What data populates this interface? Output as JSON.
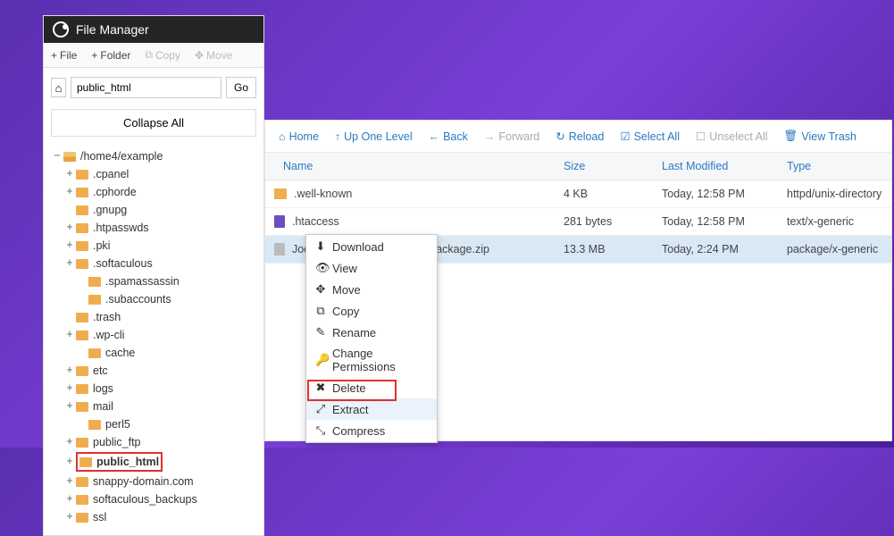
{
  "title": "File Manager",
  "toolbar": {
    "file": "File",
    "folder": "Folder",
    "copy": "Copy",
    "move": "Move"
  },
  "path_input": "public_html",
  "go": "Go",
  "collapse": "Collapse All",
  "tree": {
    "root": "/home4/example",
    "items": [
      {
        "label": ".cpanel",
        "exp": true,
        "ind": 1
      },
      {
        "label": ".cphorde",
        "exp": true,
        "ind": 1
      },
      {
        "label": ".gnupg",
        "exp": false,
        "ind": 1
      },
      {
        "label": ".htpasswds",
        "exp": true,
        "ind": 1
      },
      {
        "label": ".pki",
        "exp": true,
        "ind": 1
      },
      {
        "label": ".softaculous",
        "exp": true,
        "ind": 1
      },
      {
        "label": ".spamassassin",
        "exp": false,
        "ind": 2
      },
      {
        "label": ".subaccounts",
        "exp": false,
        "ind": 2
      },
      {
        "label": ".trash",
        "exp": false,
        "ind": 1
      },
      {
        "label": ".wp-cli",
        "exp": true,
        "ind": 1
      },
      {
        "label": "cache",
        "exp": false,
        "ind": 2
      },
      {
        "label": "etc",
        "exp": true,
        "ind": 1
      },
      {
        "label": "logs",
        "exp": true,
        "ind": 1
      },
      {
        "label": "mail",
        "exp": true,
        "ind": 1
      },
      {
        "label": "perl5",
        "exp": false,
        "ind": 2
      },
      {
        "label": "public_ftp",
        "exp": true,
        "ind": 1
      },
      {
        "label": "public_html",
        "exp": true,
        "ind": 1,
        "bold": true,
        "highlight": true
      },
      {
        "label": "snappy-domain.com",
        "exp": true,
        "ind": 1
      },
      {
        "label": "softaculous_backups",
        "exp": true,
        "ind": 1
      },
      {
        "label": "ssl",
        "exp": true,
        "ind": 1
      }
    ]
  },
  "rtoolbar": {
    "home": "Home",
    "up": "Up One Level",
    "back": "Back",
    "forward": "Forward",
    "reload": "Reload",
    "selectall": "Select All",
    "unselectall": "Unselect All",
    "viewtrash": "View Trash"
  },
  "cols": {
    "name": "Name",
    "size": "Size",
    "mod": "Last Modified",
    "type": "Type"
  },
  "rows": [
    {
      "name": ".well-known",
      "size": "4 KB",
      "mod": "Today, 12:58 PM",
      "type": "httpd/unix-directory",
      "icon": "folder"
    },
    {
      "name": ".htaccess",
      "size": "281 bytes",
      "mod": "Today, 12:58 PM",
      "type": "text/x-generic",
      "icon": "doc"
    },
    {
      "name": "Joomla_3.9.12-Stable-Full_Package.zip",
      "size": "13.3 MB",
      "mod": "Today, 2:24 PM",
      "type": "package/x-generic",
      "icon": "zip",
      "sel": true
    }
  ],
  "ctx": {
    "download": "Download",
    "view": "View",
    "move": "Move",
    "copy": "Copy",
    "rename": "Rename",
    "chperm": "Change Permissions",
    "delete": "Delete",
    "extract": "Extract",
    "compress": "Compress"
  }
}
